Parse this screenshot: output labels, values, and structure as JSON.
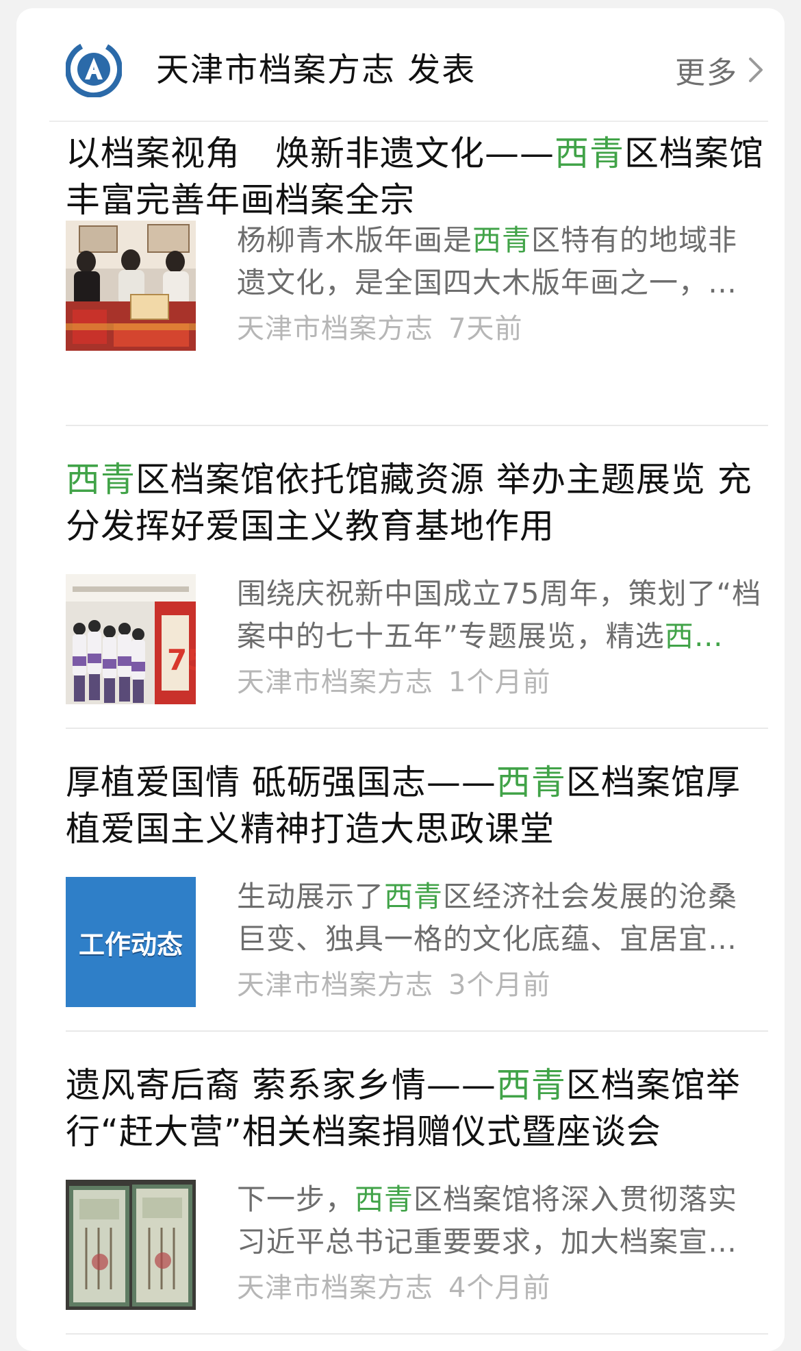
{
  "header": {
    "title": "天津市档案方志 发表",
    "more_label": "更多"
  },
  "colors": {
    "highlight": "#41a348",
    "cover_blue": "#2f7fc8"
  },
  "articles": [
    {
      "title_before": "以档案视角　焕新非遗文化——",
      "title_hl": "西青",
      "title_after": "区档案馆丰富完善年画档案全宗",
      "summary_before": "杨柳青木版年画是",
      "summary_hl": "西青",
      "summary_after": "区特有的地域非遗文化，是全国四大木版年画之一，…",
      "source": "天津市档案方志",
      "time": "7天前",
      "thumb": "photo-people-signing"
    },
    {
      "title_before": "",
      "title_hl": "西青",
      "title_after": "区档案馆依托馆藏资源 举办主题展览 充分发挥好爱国主义教育基地作用",
      "summary_before": "围绕庆祝新中国成立75周年，策划了“档案中的七十五年”专题展览，精选",
      "summary_hl": "西…",
      "summary_after": "",
      "source": "天津市档案方志",
      "time": "1个月前",
      "thumb": "photo-students-exhibition"
    },
    {
      "title_before": "厚植爱国情 砥砺强国志——",
      "title_hl": "西青",
      "title_after": "区档案馆厚植爱国主义精神打造大思政课堂",
      "summary_before": "生动展示了",
      "summary_hl": "西青",
      "summary_after": "区经济社会发展的沧桑巨变、独具一格的文化底蕴、宜居宜…",
      "source": "天津市档案方志",
      "time": "3个月前",
      "thumb": "cover-work-news",
      "cover_text": "工作动态"
    },
    {
      "title_before": "遗风寄后裔 萦系家乡情——",
      "title_hl": "西青",
      "title_after": "区档案馆举行“赶大营”相关档案捐赠仪式暨座谈会",
      "summary_before": "下一步，",
      "summary_hl": "西青",
      "summary_after": "区档案馆将深入贯彻落实习近平总书记重要要求，加大档案宣…",
      "source": "天津市档案方志",
      "time": "4个月前",
      "thumb": "photo-old-documents"
    }
  ]
}
